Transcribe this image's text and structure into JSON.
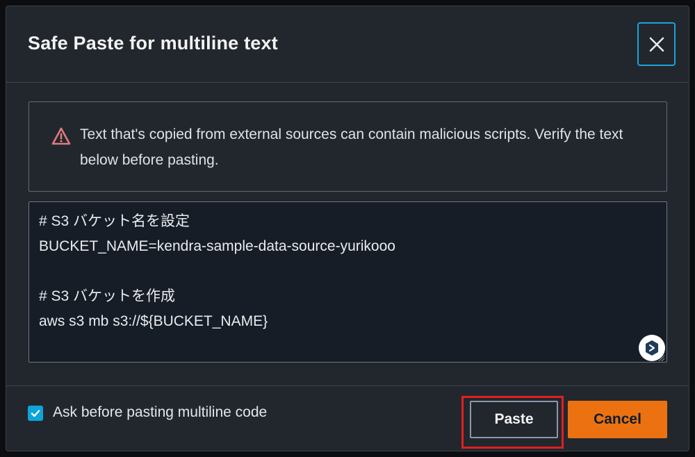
{
  "dialog": {
    "title": "Safe Paste for multiline text",
    "close_icon": "close-icon"
  },
  "warning": {
    "icon": "warning-triangle-icon",
    "icon_color": "#e07b7b",
    "text": "Text that's copied from external sources can contain malicious scripts. Verify the text below before pasting."
  },
  "code": {
    "lines": [
      "# S3 バケット名を設定",
      "BUCKET_NAME=kendra-sample-data-source-yurikooo",
      "",
      "# S3 バケットを作成",
      "aws s3 mb s3://${BUCKET_NAME}"
    ]
  },
  "footer": {
    "checkbox_label": "Ask before pasting multiline code",
    "checkbox_checked": true,
    "paste_label": "Paste",
    "cancel_label": "Cancel",
    "accent_color": "#ec7211",
    "highlight_color": "#e02020"
  }
}
